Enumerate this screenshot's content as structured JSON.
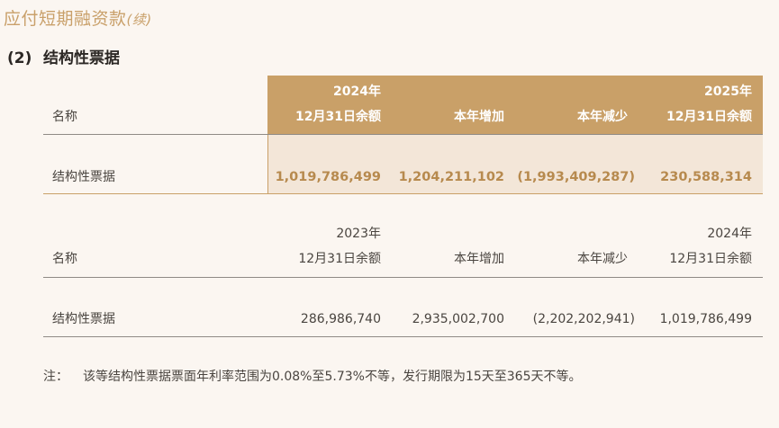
{
  "page": {
    "title": "应付短期融资款",
    "title_cont": "(续)",
    "section_num": "(2)",
    "section_title": "结构性票据"
  },
  "table_2024": {
    "headers": {
      "name": "名称",
      "opening_year": "2024年",
      "opening_label": "12月31日余额",
      "increase": "本年增加",
      "decrease": "本年减少",
      "closing_year": "2025年",
      "closing_label": "12月31日余额"
    },
    "row": {
      "name": "结构性票据",
      "opening": "1,019,786,499",
      "increase": "1,204,211,102",
      "decrease": "(1,993,409,287)",
      "closing": "230,588,314"
    }
  },
  "table_2023": {
    "headers": {
      "name": "名称",
      "opening_year": "2023年",
      "opening_label": "12月31日余额",
      "increase": "本年增加",
      "decrease": "本年减少",
      "closing_year": "2024年",
      "closing_label": "12月31日余额"
    },
    "row": {
      "name": "结构性票据",
      "opening": "286,986,740",
      "increase": "2,935,002,700",
      "decrease": "(2,202,202,941)",
      "closing": "1,019,786,499"
    }
  },
  "note": {
    "label": "注：",
    "text": "该等结构性票据票面年利率范围为0.08%至5.73%不等，发行期限为15天至365天不等。"
  },
  "colors": {
    "accent_gold": "#c9a068",
    "highlight_bg": "#f3e6d8",
    "page_bg": "#fbf6f1"
  }
}
